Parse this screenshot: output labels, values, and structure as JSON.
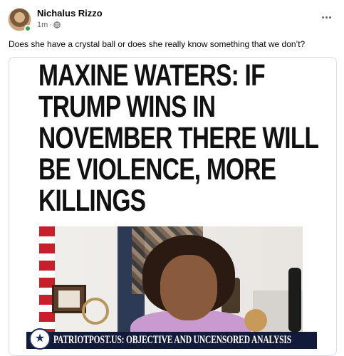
{
  "post": {
    "author_name": "Nichalus Rizzo",
    "timestamp": "1m",
    "separator": "·",
    "privacy_icon": "globe-icon",
    "more_icon": "more-options-icon",
    "text": "Does she have a crystal ball or does she really know something that we don’t?"
  },
  "shared_image": {
    "headline_lines": [
      "MAXINE WATERS: IF",
      "TRUMP WINS IN",
      "NOVEMBER THERE WILL",
      "BE VIOLENCE, MORE",
      "KILLINGS"
    ],
    "banner_text": "PATRIOTPOST.US: OBJECTIVE AND UNCENSORED ANALYSIS",
    "banner_logo_icon": "star-seal-icon"
  },
  "colors": {
    "online_status": "#31a24c",
    "banner_background": "#121a3a",
    "meta_text": "#65676b"
  }
}
